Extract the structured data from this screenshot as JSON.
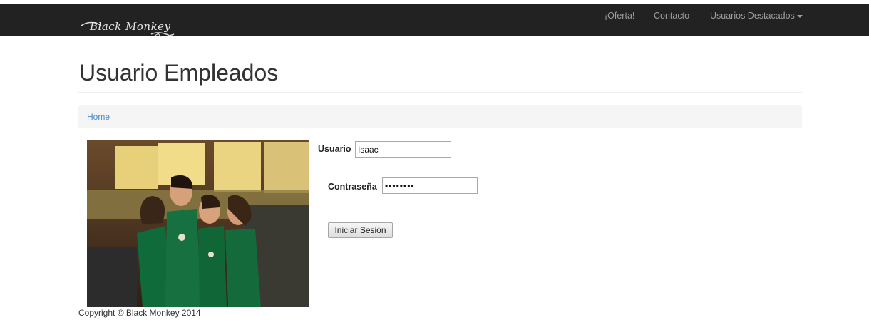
{
  "navbar": {
    "brand": "Black Monkey",
    "items": [
      {
        "label": "¡Oferta!"
      },
      {
        "label": "Contacto"
      },
      {
        "label": "Usuarios Destacados"
      }
    ]
  },
  "page": {
    "title": "Usuario Empleados"
  },
  "breadcrumb": {
    "home": "Home"
  },
  "login": {
    "usuario_label": "Usuario",
    "usuario_value": "Isaac",
    "password_label": "Contraseña",
    "password_value": "Isaac123",
    "submit_label": "Iniciar Sesión"
  },
  "footer": {
    "copyright": "Copyright © Black Monkey 2014"
  },
  "colors": {
    "navbar_bg": "#222222",
    "nav_text": "#9d9d9d",
    "link": "#428bca",
    "breadcrumb_bg": "#f5f5f5"
  }
}
